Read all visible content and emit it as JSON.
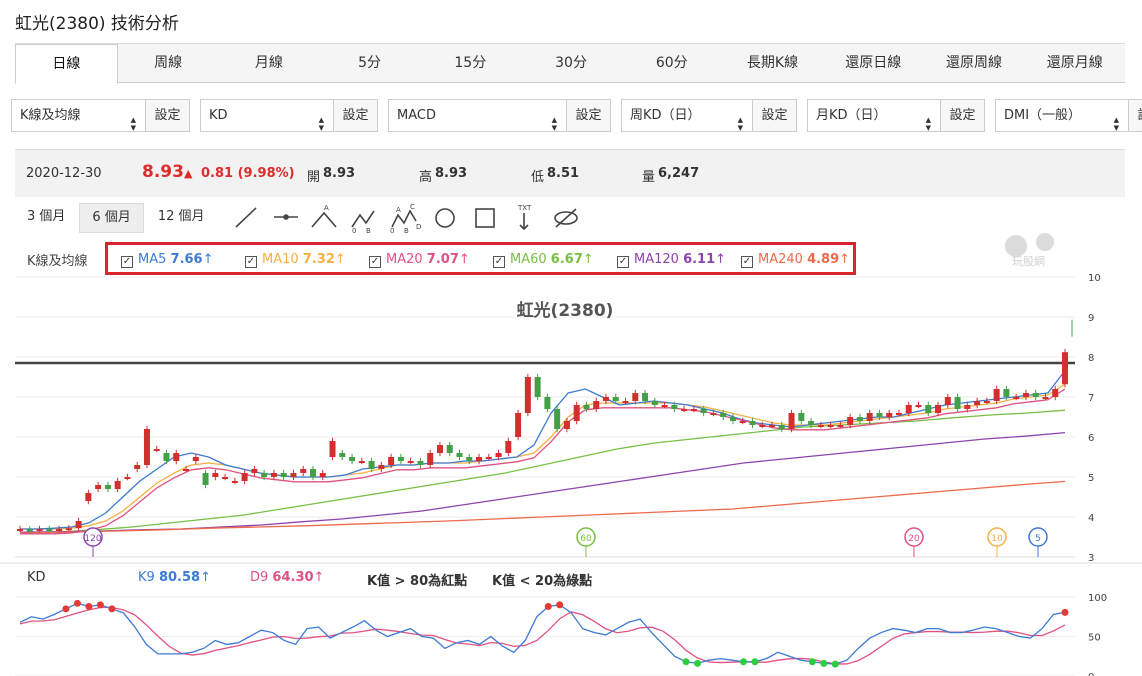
{
  "page_title": "虹光(2380) 技術分析",
  "tabs": [
    "日線",
    "周線",
    "月線",
    "5分",
    "15分",
    "30分",
    "60分",
    "長期K線",
    "還原日線",
    "還原周線",
    "還原月線"
  ],
  "selects": [
    {
      "value": "K線及均線",
      "button": "設定",
      "w": 133
    },
    {
      "value": "KD",
      "button": "設定",
      "w": 133
    },
    {
      "value": "MACD",
      "button": "設定",
      "w": 133
    },
    {
      "value": "周KD（日）",
      "button": "設定",
      "w": 133
    },
    {
      "value": "月KD（日）",
      "button": "設定",
      "w": 133
    },
    {
      "value": "DMI（一般）",
      "button": "設定",
      "w": 133
    }
  ],
  "quote": {
    "date": "2020-12-30",
    "price": "8.93",
    "arrow": "▲",
    "change": "0.81 (9.98%)",
    "open_label": "開",
    "open": "8.93",
    "high_label": "高",
    "high": "8.93",
    "low_label": "低",
    "low": "8.51",
    "vol_label": "量",
    "vol": "6,247"
  },
  "ranges": [
    "3 個月",
    "6 個月",
    "12 個月"
  ],
  "ma_panel": {
    "label": "K線及均線",
    "items": [
      {
        "name": "MA5",
        "value": "7.66",
        "dir": "↑",
        "color": "#3d7ad4"
      },
      {
        "name": "MA10",
        "value": "7.32",
        "dir": "↑",
        "color": "#f5b041"
      },
      {
        "name": "MA20",
        "value": "7.07",
        "dir": "↑",
        "color": "#e0527f"
      },
      {
        "name": "MA60",
        "value": "6.67",
        "dir": "↑",
        "color": "#77c044"
      },
      {
        "name": "MA120",
        "value": "6.11",
        "dir": "↑",
        "color": "#8e44ad"
      },
      {
        "name": "MA240",
        "value": "4.89",
        "dir": "↑",
        "color": "#ee6a4a"
      }
    ]
  },
  "watermark": "玩股網",
  "chart_data": {
    "type": "candlestick",
    "title": "虹光(2380)",
    "ylim": [
      3,
      10
    ],
    "yticks": [
      "10",
      "9",
      "8",
      "7",
      "6",
      "5",
      "4",
      "3"
    ],
    "resistance": 7.85,
    "closes": [
      3.7,
      3.68,
      3.7,
      3.69,
      3.7,
      3.72,
      3.9,
      4.6,
      4.8,
      4.7,
      4.9,
      5.0,
      5.3,
      6.2,
      5.7,
      5.4,
      5.6,
      5.2,
      5.5,
      4.8,
      5.1,
      5.0,
      4.9,
      5.1,
      5.2,
      5.0,
      5.1,
      5.0,
      5.1,
      5.2,
      5.0,
      5.1,
      5.9,
      5.5,
      5.4,
      5.4,
      5.2,
      5.3,
      5.5,
      5.4,
      5.4,
      5.3,
      5.6,
      5.8,
      5.6,
      5.5,
      5.4,
      5.5,
      5.5,
      5.6,
      5.9,
      6.6,
      7.5,
      7.0,
      6.7,
      6.2,
      6.4,
      6.8,
      6.7,
      6.9,
      7.0,
      6.9,
      6.9,
      7.1,
      6.9,
      6.8,
      6.8,
      6.7,
      6.7,
      6.7,
      6.6,
      6.6,
      6.5,
      6.4,
      6.4,
      6.3,
      6.3,
      6.3,
      6.2,
      6.6,
      6.4,
      6.3,
      6.3,
      6.3,
      6.3,
      6.5,
      6.4,
      6.6,
      6.5,
      6.6,
      6.6,
      6.8,
      6.8,
      6.6,
      6.8,
      7.0,
      6.7,
      6.8,
      6.9,
      6.9,
      7.2,
      7.0,
      7.0,
      7.1,
      7.0,
      7.0,
      7.2,
      8.12
    ],
    "opens": [
      3.7,
      3.69,
      3.7,
      3.7,
      3.7,
      3.72,
      3.72,
      4.4,
      4.7,
      4.8,
      4.7,
      5.0,
      5.2,
      5.3,
      5.7,
      5.6,
      5.4,
      5.2,
      5.4,
      5.1,
      5.0,
      5.0,
      4.9,
      4.9,
      5.1,
      5.1,
      5.0,
      5.1,
      5.0,
      5.1,
      5.2,
      5.0,
      5.5,
      5.6,
      5.5,
      5.4,
      5.4,
      5.2,
      5.3,
      5.5,
      5.4,
      5.4,
      5.3,
      5.6,
      5.8,
      5.6,
      5.5,
      5.4,
      5.5,
      5.5,
      5.6,
      6.0,
      6.6,
      7.5,
      7.0,
      6.7,
      6.2,
      6.4,
      6.8,
      6.7,
      6.9,
      7.0,
      6.9,
      6.9,
      7.1,
      6.9,
      6.8,
      6.8,
      6.7,
      6.7,
      6.7,
      6.6,
      6.6,
      6.5,
      6.4,
      6.4,
      6.3,
      6.3,
      6.3,
      6.2,
      6.6,
      6.4,
      6.3,
      6.3,
      6.3,
      6.3,
      6.5,
      6.4,
      6.6,
      6.5,
      6.6,
      6.6,
      6.8,
      6.8,
      6.6,
      6.8,
      7.0,
      6.7,
      6.8,
      6.9,
      6.9,
      7.2,
      7.0,
      7.0,
      7.1,
      7.0,
      7.0,
      7.32
    ],
    "ma": {
      "MA5": [
        3.7,
        3.7,
        3.72,
        3.75,
        3.85,
        4.1,
        4.5,
        4.9,
        5.2,
        5.5,
        5.6,
        5.5,
        5.3,
        5.2,
        5.1,
        5.05,
        5.0,
        5.0,
        5.0,
        5.05,
        5.2,
        5.25,
        5.3,
        5.3,
        5.35,
        5.35,
        5.4,
        5.4,
        5.45,
        5.5,
        5.8,
        6.6,
        7.1,
        7.2,
        7.0,
        6.8,
        6.85,
        6.9,
        6.85,
        6.8,
        6.7,
        6.6,
        6.45,
        6.35,
        6.3,
        6.25,
        6.3,
        6.35,
        6.4,
        6.45,
        6.5,
        6.5,
        6.6,
        6.7,
        6.8,
        6.85,
        6.9,
        6.95,
        7.0,
        7.05,
        7.1,
        7.66
      ],
      "MA10": [
        3.7,
        3.7,
        3.7,
        3.72,
        3.78,
        3.9,
        4.15,
        4.5,
        4.85,
        5.1,
        5.3,
        5.35,
        5.3,
        5.2,
        5.1,
        5.05,
        5.0,
        5.0,
        5.0,
        5.05,
        5.1,
        5.2,
        5.3,
        5.3,
        5.35,
        5.35,
        5.35,
        5.4,
        5.45,
        5.5,
        5.6,
        6.0,
        6.5,
        6.8,
        6.85,
        6.85,
        6.85,
        6.85,
        6.85,
        6.8,
        6.75,
        6.65,
        6.55,
        6.45,
        6.35,
        6.3,
        6.3,
        6.3,
        6.35,
        6.4,
        6.45,
        6.5,
        6.55,
        6.6,
        6.7,
        6.75,
        6.8,
        6.85,
        6.95,
        7.0,
        7.05,
        7.32
      ]
    },
    "kd": {
      "label": "KD",
      "k_label": "K9",
      "k": "80.58",
      "d_label": "D9",
      "d": "64.30",
      "dir": "↑",
      "note1": "K值 > 80為紅點",
      "note2": "K值 < 20為綠點",
      "yticks": [
        "100",
        "50",
        "0"
      ]
    },
    "ma_markers": [
      "120",
      "60",
      "20",
      "10",
      "5"
    ]
  }
}
